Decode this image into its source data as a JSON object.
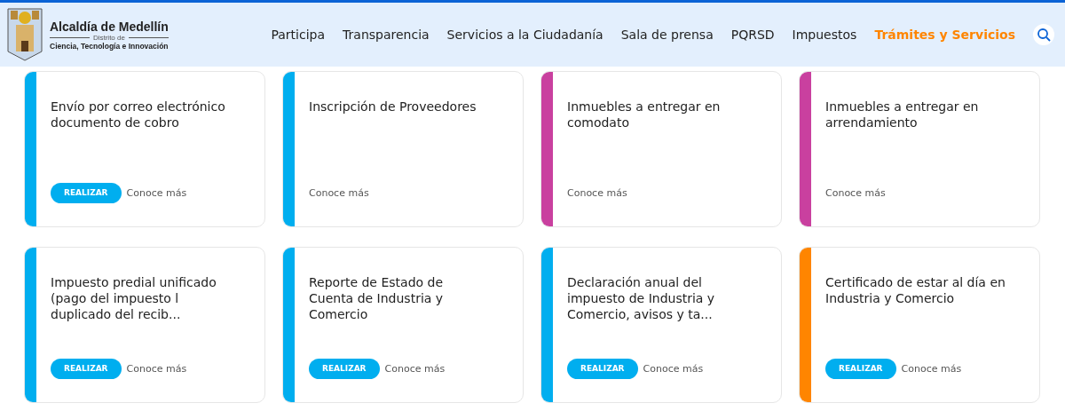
{
  "header": {
    "logo": {
      "title": "Alcaldía de Medellín",
      "subtitle": "Distrito de",
      "tagline": "Ciencia, Tecnología e Innovación"
    },
    "nav": [
      {
        "label": "Participa",
        "selected": false
      },
      {
        "label": "Transparencia",
        "selected": false
      },
      {
        "label": "Servicios a la Ciudadanía",
        "selected": false
      },
      {
        "label": "Sala de prensa",
        "selected": false
      },
      {
        "label": "PQRSD",
        "selected": false
      },
      {
        "label": "Impuestos",
        "selected": false
      },
      {
        "label": "Trámites y Servicios",
        "selected": true
      }
    ]
  },
  "cards": [
    {
      "title": "Envío por correo electrónico documento de cobro",
      "color": "#00aeef",
      "button": "REALIZAR",
      "link": "Conoce más"
    },
    {
      "title": "Inscripción de Proveedores",
      "color": "#00aeef",
      "link": "Conoce más"
    },
    {
      "title": "Inmuebles a entregar en comodato",
      "color": "#c9409f",
      "link": "Conoce más"
    },
    {
      "title": "Inmuebles a entregar en arrendamiento",
      "color": "#c9409f",
      "link": "Conoce más"
    },
    {
      "title": "Impuesto predial unificado (pago del impuesto l duplicado del recib...",
      "color": "#00aeef",
      "button": "REALIZAR",
      "link": "Conoce más"
    },
    {
      "title": "Reporte de Estado de Cuenta de Industria y Comercio",
      "color": "#00aeef",
      "button": "REALIZAR",
      "link": "Conoce más"
    },
    {
      "title": "Declaración anual del impuesto de Industria y Comercio, avisos y ta...",
      "color": "#00aeef",
      "button": "REALIZAR",
      "link": "Conoce más"
    },
    {
      "title": "Certificado de estar al día en Industria y Comercio",
      "color": "#ff8500",
      "button": "REALIZAR",
      "link": "Conoce más"
    }
  ]
}
